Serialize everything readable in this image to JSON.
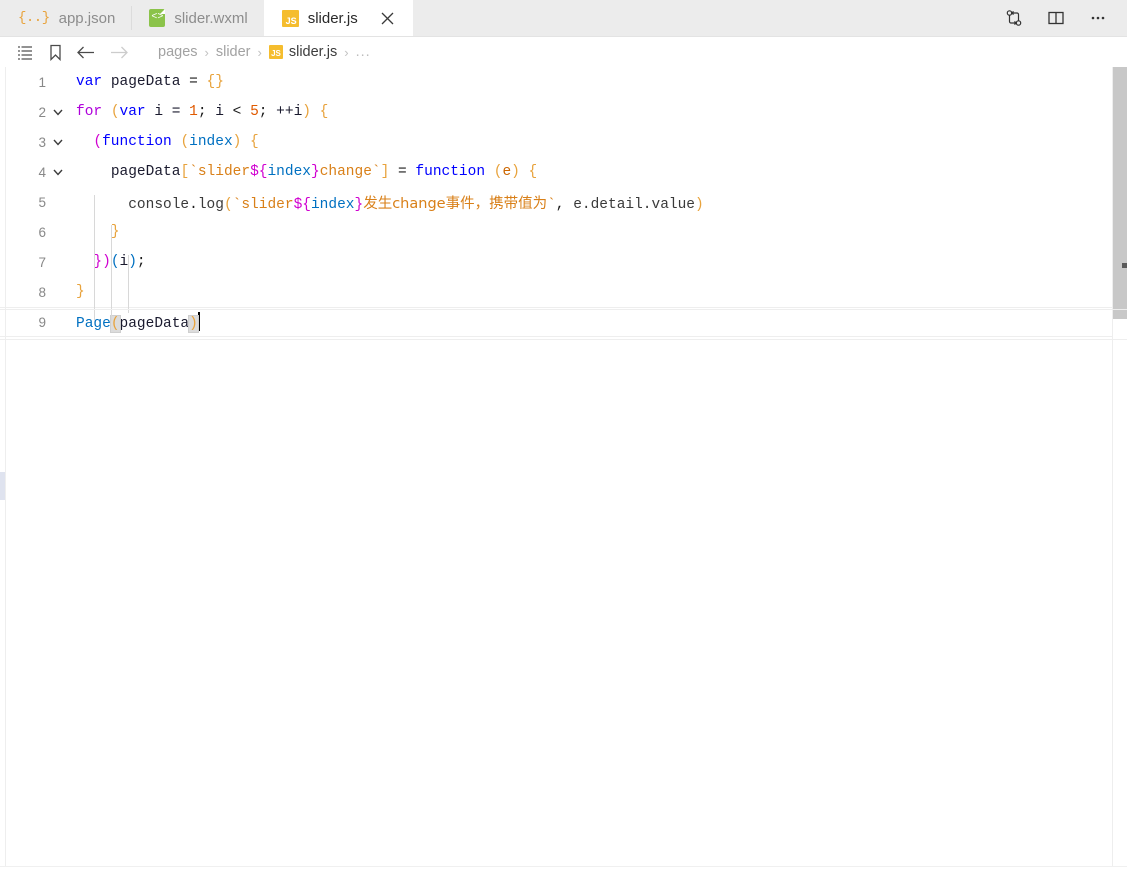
{
  "tabs": [
    {
      "label": "app.json",
      "icon": "json-file-icon",
      "icon_glyph": "{..}",
      "active": false
    },
    {
      "label": "slider.wxml",
      "icon": "wxml-file-icon",
      "icon_glyph": "<>",
      "active": false
    },
    {
      "label": "slider.js",
      "icon": "js-file-icon",
      "icon_glyph": "JS",
      "active": true
    }
  ],
  "tabbar_actions": [
    {
      "name": "source-control-icon",
      "title": "Source Control"
    },
    {
      "name": "split-editor-icon",
      "title": "Split Editor"
    },
    {
      "name": "more-actions-icon",
      "title": "More Actions..."
    }
  ],
  "breadcrumb_bar": {
    "icons": [
      {
        "name": "outline-list-icon",
        "enabled": true
      },
      {
        "name": "bookmark-icon",
        "enabled": true
      },
      {
        "name": "back-arrow-icon",
        "enabled": true
      },
      {
        "name": "forward-arrow-icon",
        "enabled": false
      }
    ],
    "parts": [
      {
        "label": "pages",
        "current": false,
        "icon": ""
      },
      {
        "label": "slider",
        "current": false,
        "icon": ""
      },
      {
        "label": "slider.js",
        "current": true,
        "icon": "js-file-icon"
      }
    ],
    "separator": "›",
    "trailing": "..."
  },
  "editor": {
    "language": "javascript",
    "file_name": "slider.js",
    "cursor_line": 9,
    "total_lines": 9,
    "line_numbers": [
      "1",
      "2",
      "3",
      "4",
      "5",
      "6",
      "7",
      "8",
      "9"
    ],
    "lines": [
      {
        "n": "1",
        "text": "var pageData = {}",
        "folding": false
      },
      {
        "n": "2",
        "text": "for (var i = 1; i < 5; ++i) {",
        "folding": true
      },
      {
        "n": "3",
        "text": "  (function (index) {",
        "folding": true
      },
      {
        "n": "4",
        "text": "    pageData[`slider${index}change`] = function (e) {",
        "folding": true
      },
      {
        "n": "5",
        "text": "      console.log(`slider${index}发生change事件，携带值为`, e.detail.value)",
        "folding": false
      },
      {
        "n": "6",
        "text": "    }",
        "folding": false
      },
      {
        "n": "7",
        "text": "  })(i);",
        "folding": false
      },
      {
        "n": "8",
        "text": "}",
        "folding": false
      },
      {
        "n": "9",
        "text": "Page(pageData)",
        "folding": false
      }
    ],
    "tokens": {
      "l1": {
        "kw_var": "var",
        "name": "pageData",
        "eq": " = ",
        "braces": "{}"
      },
      "l2": {
        "kw_for": "for",
        "paren_open": "(",
        "kw_var": "var",
        "i1": " i = ",
        "n1": "1",
        "semi1": "; ",
        "i2": "i",
        "lt": " < ",
        "n5": "5",
        "semi2": "; ",
        "inc": "++i",
        "paren_close": ")",
        "brace": " {"
      },
      "l3": {
        "paren_open": "(",
        "kw_function": "function",
        "sp": " ",
        "p_open": "(",
        "param": "index",
        "p_close": ")",
        "brace": " {"
      },
      "l4": {
        "name": "pageData",
        "br_open": "[",
        "tick1": "`",
        "str1": "slider",
        "tmpl_open": "${",
        "tmpl_var": "index",
        "tmpl_close": "}",
        "str2": "change",
        "tick2": "`",
        "br_close": "]",
        "eq": " = ",
        "kw_function": "function",
        "p_open": "(",
        "param": "e",
        "p_close": ")",
        "brace": " {"
      },
      "l5": {
        "obj": "console",
        "dot1": ".",
        "method": "log",
        "p_open": "(",
        "tick1": "`",
        "str1": "slider",
        "tmpl_open": "${",
        "tmpl_var": "index",
        "tmpl_close": "}",
        "str2": "发生change事件，携带值为",
        "tick2": "`",
        "comma": ", ",
        "arg": "e.detail.value",
        "p_close": ")"
      },
      "l6": {
        "brace": "}"
      },
      "l7": {
        "brace_close": "}",
        "p_close": ")",
        "p_open2": "(",
        "arg": "i",
        "p_close2": ")",
        "semi": ";"
      },
      "l8": {
        "brace": "}"
      },
      "l9": {
        "fn": "Page",
        "p_open": "(",
        "arg": "pageData",
        "p_close": ")"
      }
    }
  },
  "colors": {
    "accent_js": "#f5bd2e",
    "accent_wxml": "#8bc34a",
    "accent_json": "#e8a33d",
    "keyword": "#0000ff",
    "control": "#af00db",
    "string": "#d98019",
    "number": "#e05a00",
    "bracket_amber": "#e8a33d",
    "bracket_magenta": "#d000d0",
    "bracket_blue": "#0070c1",
    "tabbar_bg": "#ececec",
    "editor_bg": "#ffffff"
  }
}
